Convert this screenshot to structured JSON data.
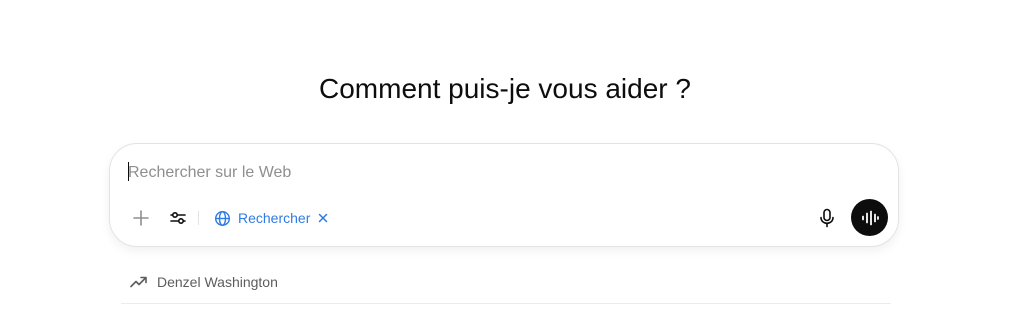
{
  "heading": "Comment puis-je vous aider ?",
  "composer": {
    "placeholder": "Rechercher sur le Web",
    "value": "",
    "search_pill_label": "Rechercher"
  },
  "icons": {
    "add": "plus-icon",
    "tools": "sliders-icon",
    "search_pill": "globe-icon",
    "remove_pill": "close-icon",
    "dictate": "microphone-icon",
    "voice": "voice-waveform-icon",
    "trending": "trending-up-icon"
  },
  "colors": {
    "accent": "#2f7be5",
    "voice_button": "#0d0d0d"
  },
  "suggestions": [
    {
      "label": "Denzel Washington"
    }
  ]
}
